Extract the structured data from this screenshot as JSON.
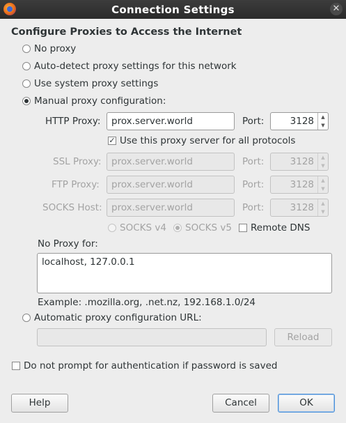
{
  "window": {
    "title": "Connection Settings"
  },
  "heading": "Configure Proxies to Access the Internet",
  "options": {
    "no_proxy": "No proxy",
    "auto_detect": "Auto-detect proxy settings for this network",
    "system": "Use system proxy settings",
    "manual": "Manual proxy configuration:",
    "auto_url": "Automatic proxy configuration URL:"
  },
  "http": {
    "label": "HTTP Proxy:",
    "value": "prox.server.world",
    "port_label": "Port:",
    "port": "3128"
  },
  "all_protocols": {
    "label": "Use this proxy server for all protocols",
    "checked": true
  },
  "ssl": {
    "label": "SSL Proxy:",
    "value": "prox.server.world",
    "port_label": "Port:",
    "port": "3128"
  },
  "ftp": {
    "label": "FTP Proxy:",
    "value": "prox.server.world",
    "port_label": "Port:",
    "port": "3128"
  },
  "socks": {
    "label": "SOCKS Host:",
    "value": "prox.server.world",
    "port_label": "Port:",
    "port": "3128",
    "v4": "SOCKS v4",
    "v5": "SOCKS v5",
    "remote_dns": "Remote DNS"
  },
  "no_proxy_for": {
    "label": "No Proxy for:",
    "value": "localhost, 127.0.0.1",
    "example": "Example: .mozilla.org, .net.nz, 192.168.1.0/24"
  },
  "auto_url_value": "",
  "reload": "Reload",
  "no_auth_prompt": "Do not prompt for authentication if password is saved",
  "buttons": {
    "help": "Help",
    "cancel": "Cancel",
    "ok": "OK"
  }
}
